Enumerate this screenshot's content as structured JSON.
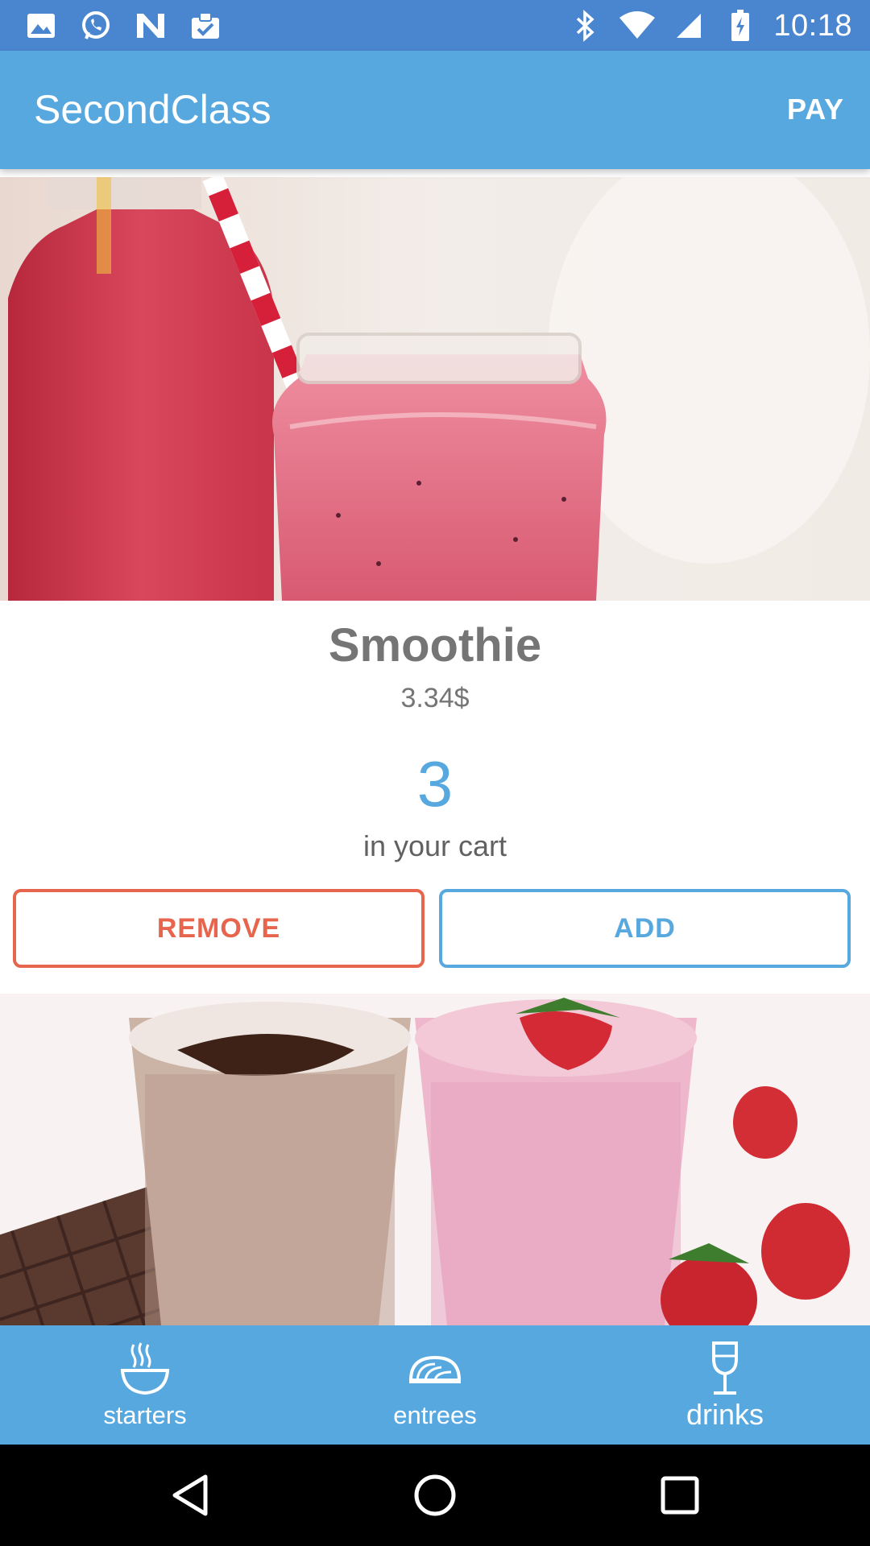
{
  "status_bar": {
    "time": "10:18",
    "left_icons": [
      "image-icon",
      "whatsapp-icon",
      "n-app-icon",
      "clipboard-check-icon"
    ],
    "right_icons": [
      "bluetooth-icon",
      "wifi-icon",
      "signal-icon",
      "battery-icon"
    ]
  },
  "app_bar": {
    "title": "SecondClass",
    "action_label": "PAY"
  },
  "item": {
    "name": "Smoothie",
    "price": "3.34$",
    "cart_count": "3",
    "cart_label": "in your cart"
  },
  "buttons": {
    "remove_label": "REMOVE",
    "add_label": "ADD"
  },
  "bottom_nav": {
    "items": [
      {
        "label": "starters",
        "icon": "soup-bowl-icon"
      },
      {
        "label": "entrees",
        "icon": "pasta-icon"
      },
      {
        "label": "drinks",
        "icon": "wine-glass-icon"
      }
    ],
    "active": "drinks"
  },
  "colors": {
    "status_bar": "#4a86d0",
    "primary": "#58a8e0",
    "remove": "#e8654d",
    "text_gray": "#757575"
  }
}
